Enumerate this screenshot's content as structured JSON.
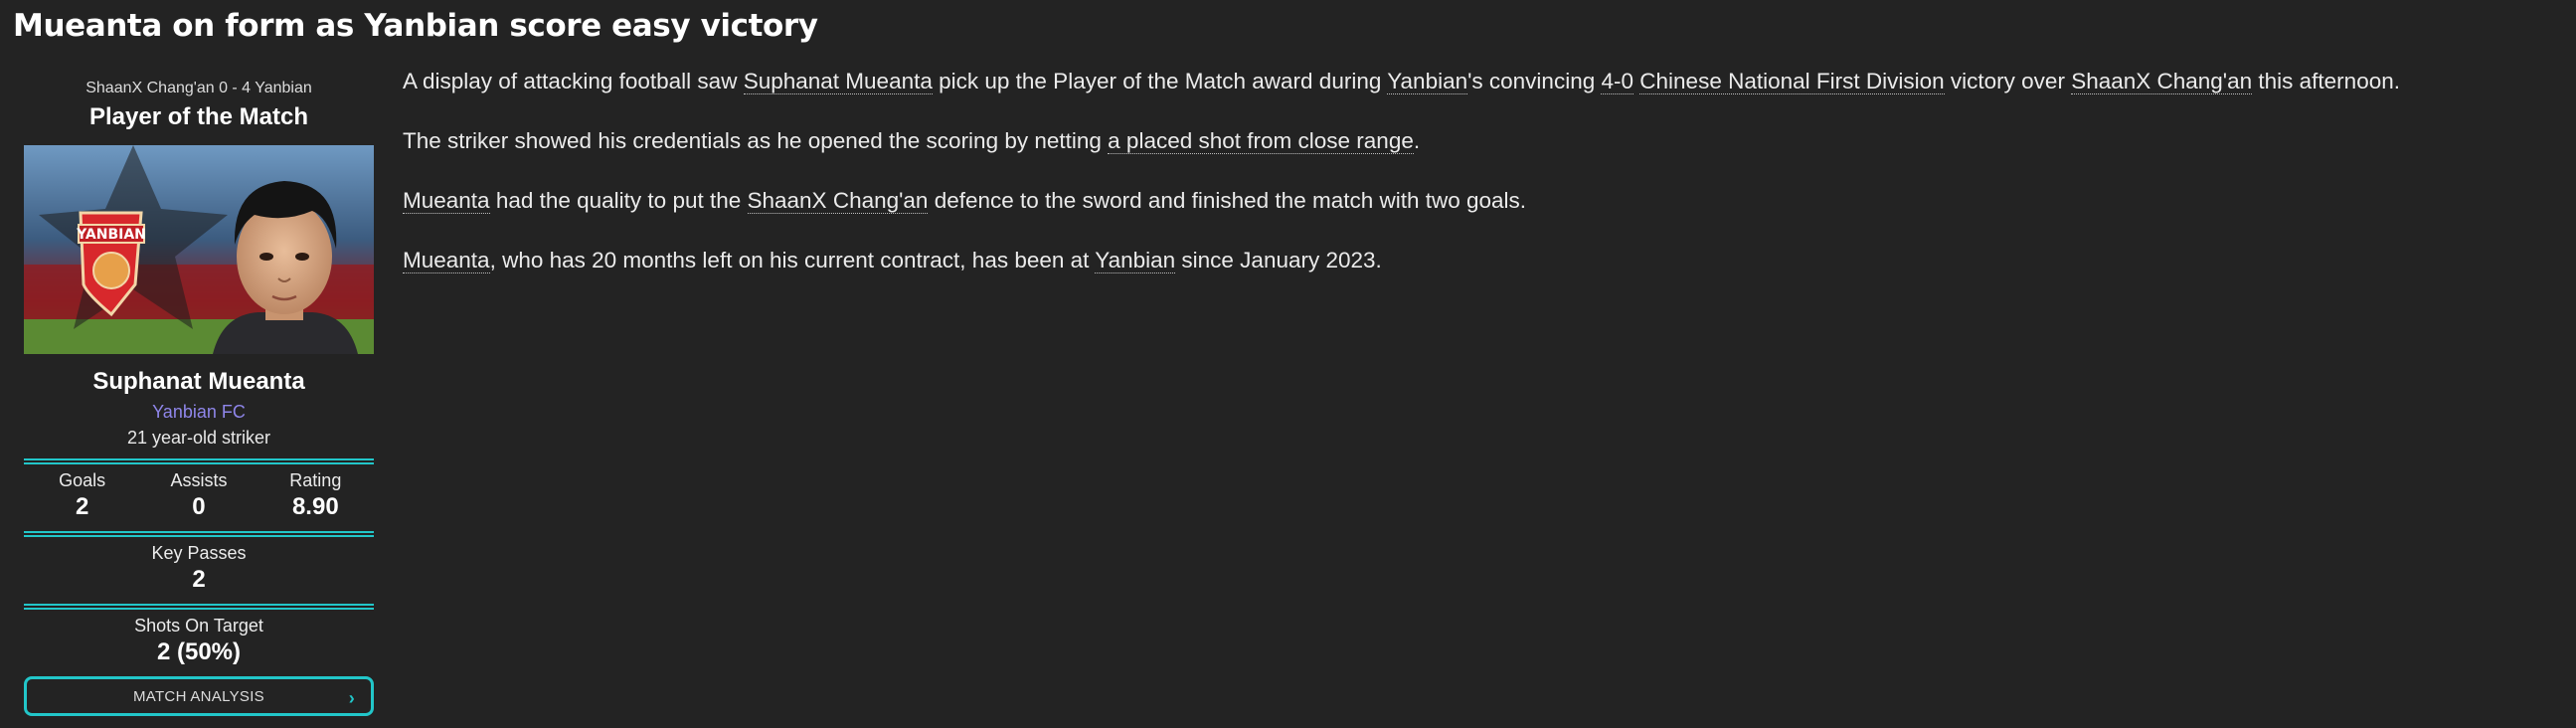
{
  "headline": "Mueanta on form as Yanbian score easy victory",
  "potm": {
    "match_score": "ShaanX Chang'an 0 - 4 Yanbian",
    "title": "Player of the Match",
    "badge_text": "YANBIAN",
    "player_name": "Suphanat Mueanta",
    "club": "Yanbian FC",
    "description": "21 year-old striker",
    "stats": [
      {
        "label": "Goals",
        "value": "2"
      },
      {
        "label": "Assists",
        "value": "0"
      },
      {
        "label": "Rating",
        "value": "8.90"
      }
    ],
    "key_passes": {
      "label": "Key Passes",
      "value": "2"
    },
    "shots_on_target": {
      "label": "Shots On Target",
      "value": "2 (50%)"
    },
    "analysis_button": "MATCH ANALYSIS",
    "accent_color": "#22c6c9",
    "club_link_color": "#8f86ea"
  },
  "article": {
    "p1": {
      "t1": "A display of attacking football saw ",
      "l1": "Suphanat Mueanta",
      "t2": " pick up the Player of the Match award during ",
      "l2": "Yanbian",
      "t3": "'s convincing ",
      "l3": "4-0",
      "t4": " ",
      "l4": "Chinese National First Division",
      "t5": " victory over ",
      "l5": "ShaanX Chang'an",
      "t6": " this afternoon."
    },
    "p2": {
      "t1": "The striker showed his credentials as he opened the scoring by netting ",
      "l1": "a placed shot from close range",
      "t2": "."
    },
    "p3": {
      "l1": "Mueanta",
      "t1": " had the quality to put the ",
      "l2": "ShaanX Chang'an",
      "t2": " defence to the sword and finished the match with two goals."
    },
    "p4": {
      "l1": "Mueanta",
      "t1": ", who has 20 months left on his current contract, has been at ",
      "l2": "Yanbian",
      "t2": " since January 2023."
    }
  }
}
